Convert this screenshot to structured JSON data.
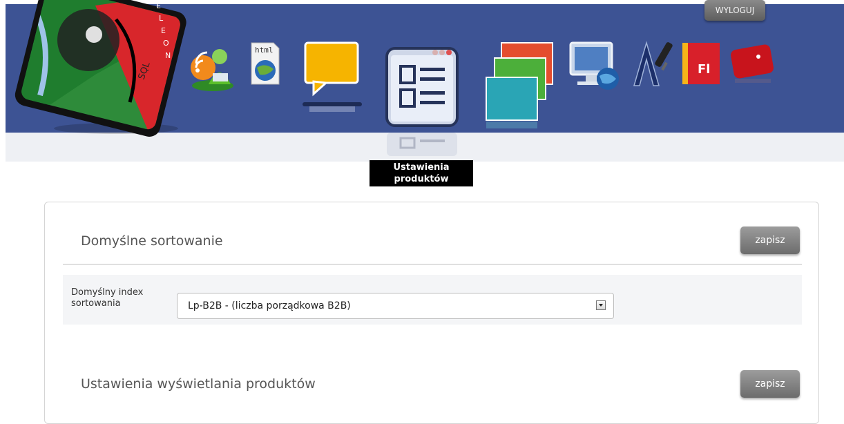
{
  "header": {
    "logout_label": "WYLOGUJ",
    "logo_letters": [
      "E",
      "L",
      "E",
      "O",
      "N"
    ],
    "logo_sql": "SQL",
    "active_tooltip_line1": "Ustawienia",
    "active_tooltip_line2": "produktów",
    "html_icon_text": "html",
    "fl_icon_text": "Fl"
  },
  "sections": {
    "sorting": {
      "title": "Domyślne sortowanie",
      "save_label": "zapisz",
      "field_label_line1": "Domyślny index",
      "field_label_line2": "sortowania",
      "select_value": "Lp-B2B - (liczba porządkowa B2B)"
    },
    "display": {
      "title": "Ustawienia wyświetlania produktów",
      "save_label": "zapisz"
    }
  },
  "colors": {
    "header_bg": "#3d5394",
    "subbar_bg": "#eef0f4",
    "tooltip_bg": "#000000",
    "button_bg": "#7c7c7c"
  }
}
